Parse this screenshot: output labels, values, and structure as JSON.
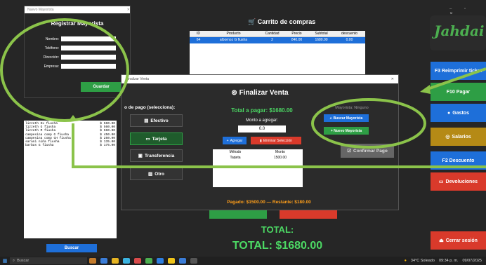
{
  "window_controls": "–  ▫  ✕",
  "cart": {
    "title": "Carrito de compras",
    "headers": [
      "ID",
      "Producto",
      "Cantidad",
      "Precio",
      "Subtotal",
      "descuento"
    ],
    "row": [
      "64",
      "albornoz G fiusha",
      "2",
      "840.00",
      "1680.00",
      "0.00"
    ]
  },
  "logo": "Jahdai",
  "sidebar": {
    "reimprimir": "F3 Reimprimir ticket",
    "pagar": "F10 Pagar",
    "gastos": "Gastos",
    "salarios": "Salarios",
    "descuento": "F2 Descuento",
    "devoluciones": "Devoluciones",
    "cerrar": "Cerrar sesión"
  },
  "products_list": [
    [
      "lizzeth Ex fiusha",
      "$ 560.00"
    ],
    [
      "lizzeth G fiusha",
      "$ 560.00"
    ],
    [
      "lizzeth M fiusha",
      "$ 560.00"
    ],
    [
      "campesina comp G fiusha",
      "$ 450.00"
    ],
    [
      "campesina comp CH fiusha",
      "$ 250.00"
    ],
    [
      "sarani niña fiusha",
      "$ 135.00"
    ],
    [
      "barbas G fiusha",
      "$ 175.00"
    ]
  ],
  "buscar_label": "Buscar",
  "registrar": {
    "window_title": "Nuevo Mayorista",
    "title": "Registrar Mayorista",
    "nombre": "Nombre:",
    "telefono": "Teléfono:",
    "direccion": "Dirección:",
    "empresa": "Empresa:",
    "guardar": "Guardar"
  },
  "dialog": {
    "window_title": "Finalizar Venta",
    "title": "Finalizar Venta",
    "pago_label": "o de pago (selecciona):",
    "efectivo": "Efectivo",
    "tarjeta": "Tarjeta",
    "transferencia": "Transferencia",
    "otro": "Otro",
    "total_pagar": "Total a pagar: $1680.00",
    "monto_label": "Monto a agregar:",
    "monto_value": "0.0",
    "agregar": "Agregar",
    "eliminar": "Eliminar Selección",
    "pagos_headers": [
      "Método",
      "Monto"
    ],
    "pagos_row": [
      "Tarjeta",
      "1500.00"
    ],
    "pagado": "Pagado: $1500.00  —  Restante: $180.00",
    "mayorista_status": "Mayorista: Ninguno",
    "buscar_mayorista": "Buscar Mayorista",
    "nuevo_mayorista": "+ Nuevo Mayorista",
    "confirmar": "Confirmar Pago"
  },
  "totals": {
    "label": "TOTAL:",
    "value": "TOTAL: $1680.00"
  },
  "taskbar": {
    "search": "Buscar",
    "weather": "34°C Soleado",
    "time": "09:34 p. m.",
    "date": "09/07/2025"
  },
  "colors": {
    "accent_blue": "#1e6fd9",
    "accent_green": "#2e9e45",
    "accent_red": "#d93a2b",
    "annotation_green": "#8bc34a"
  }
}
